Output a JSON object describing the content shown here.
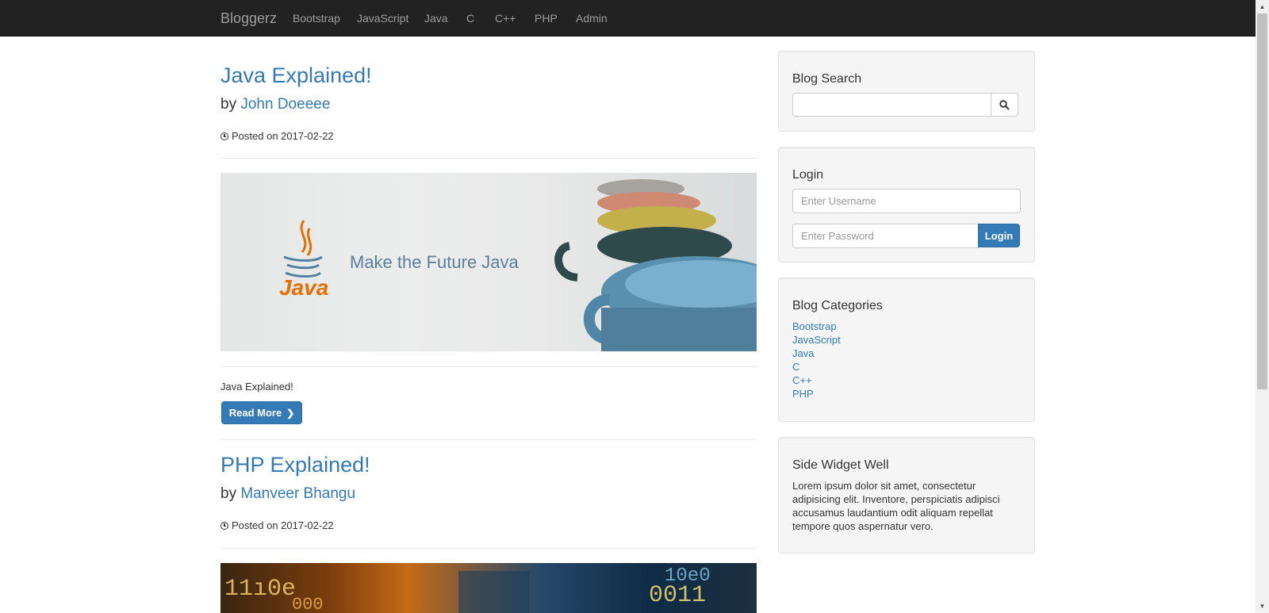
{
  "navbar": {
    "brand": "Bloggerz",
    "items": [
      "Bootstrap",
      "JavaScript",
      "Java",
      "C",
      "C++",
      "PHP",
      "Admin"
    ]
  },
  "posts": [
    {
      "title": "Java Explained!",
      "author_prefix": "by",
      "author": "John Doeeee",
      "date": "Posted on 2017-02-22",
      "image_caption": "Make the Future Java",
      "image_logo_text": "Java",
      "excerpt": "Java Explained!",
      "read_more": "Read More"
    },
    {
      "title": "PHP Explained!",
      "author_prefix": "by",
      "author": "Manveer Bhangu",
      "date": "Posted on 2017-02-22"
    }
  ],
  "sidebar": {
    "search": {
      "title": "Blog Search",
      "icon": "search-icon"
    },
    "login": {
      "title": "Login",
      "username_placeholder": "Enter Username",
      "password_placeholder": "Enter Password",
      "button": "Login"
    },
    "categories": {
      "title": "Blog Categories",
      "items": [
        "Bootstrap",
        "JavaScript",
        "Java",
        "C",
        "C++",
        "PHP"
      ]
    },
    "widget": {
      "title": "Side Widget Well",
      "text": "Lorem ipsum dolor sit amet, consectetur adipisicing elit. Inventore, perspiciatis adipisci accusamus laudantium odit aliquam repellat tempore quos aspernatur vero."
    }
  },
  "colors": {
    "navbar_bg": "#222222",
    "link": "#337ab7",
    "button": "#337ab7",
    "java_orange": "#e76f00"
  }
}
